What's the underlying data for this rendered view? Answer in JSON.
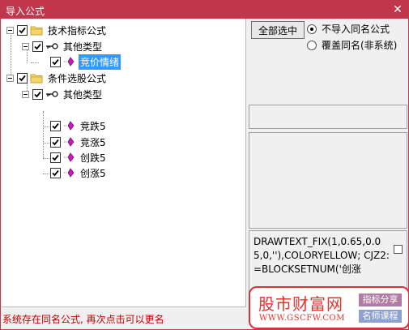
{
  "window": {
    "title": "导入公式",
    "close_glyph": "✕"
  },
  "tree": {
    "groups": [
      {
        "label": "技术指标公式",
        "checked": true,
        "subgroups": [
          {
            "label": "其他类型",
            "checked": true,
            "items": [
              {
                "label": "竞价情绪",
                "checked": true,
                "selected": true
              }
            ]
          }
        ]
      },
      {
        "label": "条件选股公式",
        "checked": true,
        "subgroups": [
          {
            "label": "其他类型",
            "checked": true,
            "items": [
              {
                "label": "竞跌5",
                "checked": true
              },
              {
                "label": "竞涨5",
                "checked": true
              },
              {
                "label": "创跌5",
                "checked": true
              },
              {
                "label": "创涨5",
                "checked": true
              }
            ]
          }
        ]
      }
    ]
  },
  "controls": {
    "select_all_label": "全部选中",
    "radio_options": [
      {
        "label": "不导入同名公式",
        "selected": true
      },
      {
        "label": "覆盖同名(非系统)",
        "selected": false
      }
    ]
  },
  "code_preview": {
    "text": "DRAWTEXT_FIX(1,0.65,0.05,0,''),COLORYELLOW;\nCJZ2:=BLOCKSETNUM('创涨"
  },
  "status_text": "系统存在同名公式, 再次点击可以更名",
  "watermark": {
    "logo": "股市财富网",
    "url": "WWW.GSCFW.COM",
    "badge1": "指标分享",
    "badge2": "名师课程"
  },
  "colors": {
    "titlebar": "#c1364a",
    "selection": "#3399ff",
    "status": "#c00000",
    "watermark": "#e3322c"
  }
}
